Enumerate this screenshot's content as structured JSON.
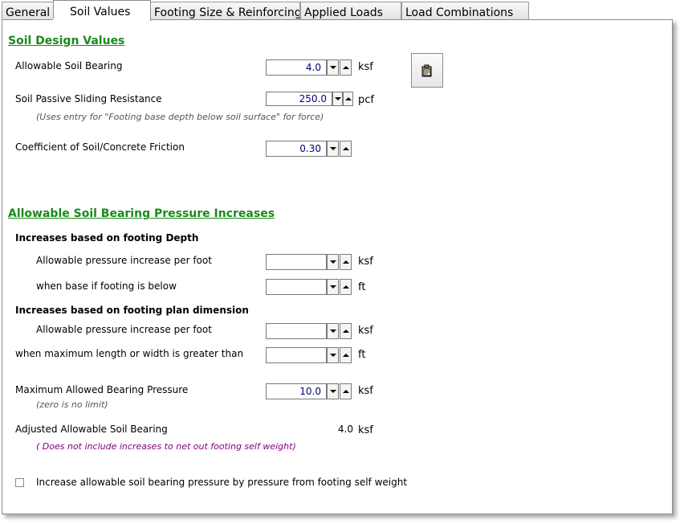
{
  "tabs": [
    {
      "label": "General"
    },
    {
      "label": "Soil Values"
    },
    {
      "label": "Footing Size & Reinforcing"
    },
    {
      "label": "Applied Loads"
    },
    {
      "label": "Load Combinations"
    }
  ],
  "active_tab": "Soil Values",
  "soil_design": {
    "heading": "Soil Design Values",
    "allowable_bearing": {
      "label": "Allowable Soil Bearing",
      "value": "4.0",
      "unit": "ksf"
    },
    "passive_sliding": {
      "label": "Soil Passive Sliding Resistance",
      "value": "250.0",
      "unit": "pcf",
      "note": "(Uses entry for \"Footing base depth below soil surface\" for force)"
    },
    "friction": {
      "label": "Coefficient of Soil/Concrete Friction",
      "value": "0.30"
    }
  },
  "increases": {
    "heading": "Allowable Soil Bearing Pressure Increases",
    "depth_heading": "Increases based on footing Depth",
    "depth_increase": {
      "label": "Allowable pressure increase per foot",
      "value": "",
      "unit": "ksf"
    },
    "depth_base": {
      "label": "when base if footing is below",
      "value": "",
      "unit": "ft"
    },
    "plan_heading": "Increases based on footing plan dimension",
    "plan_increase": {
      "label": "Allowable pressure increase per foot",
      "value": "",
      "unit": "ksf"
    },
    "plan_max": {
      "label": "when maximum length or width is greater than",
      "value": "",
      "unit": "ft"
    },
    "max_pressure": {
      "label": "Maximum Allowed Bearing Pressure",
      "value": "10.0",
      "unit": "ksf",
      "note": "(zero is no limit)"
    },
    "adjusted": {
      "label": "Adjusted Allowable Soil Bearing",
      "value": "4.0",
      "unit": "ksf",
      "note": "( Does not include increases to net out footing self weight)"
    }
  },
  "self_weight_checkbox": {
    "label": "Increase allowable soil bearing pressure by pressure from footing self weight",
    "checked": false
  },
  "colors": {
    "heading": "#1a8a1a",
    "value_text": "#000080",
    "note_purple": "#800080"
  },
  "icons": {
    "calc_button": "clipboard-icon"
  }
}
